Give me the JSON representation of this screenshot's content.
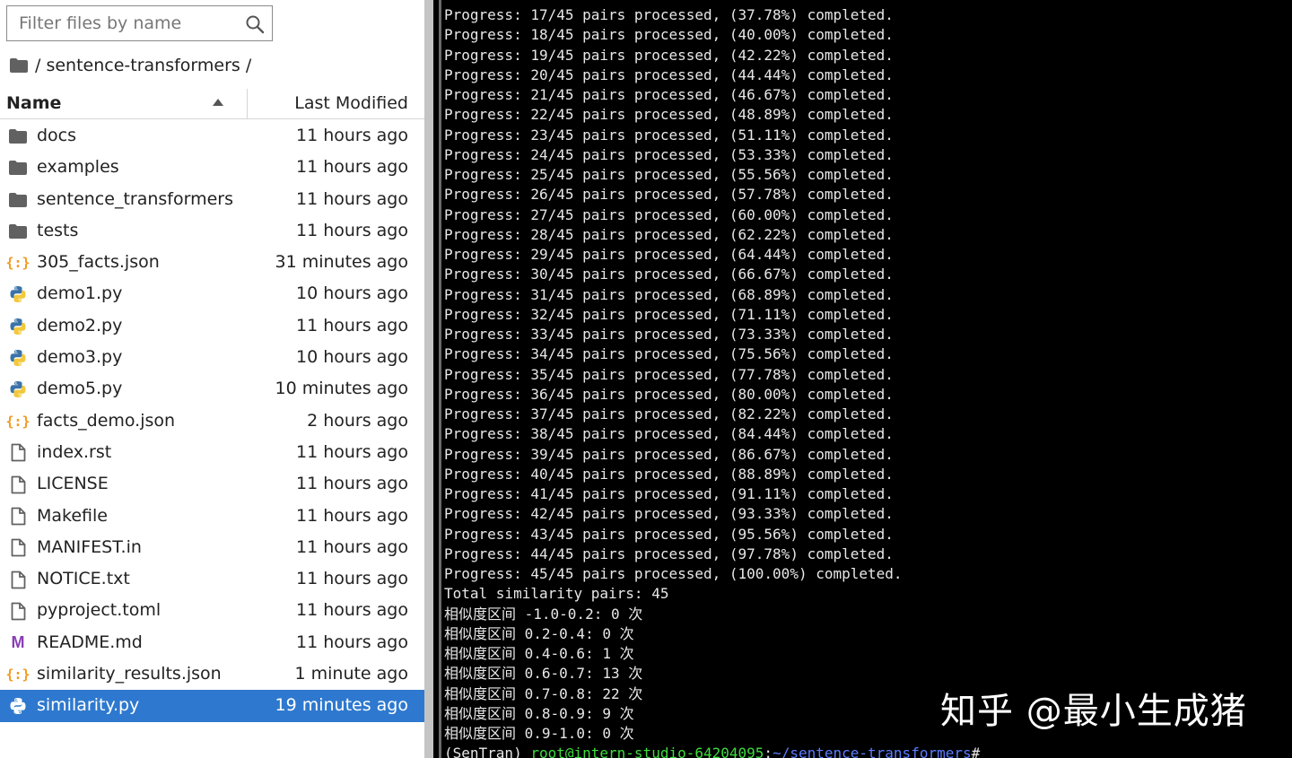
{
  "file_browser": {
    "search": {
      "placeholder": "Filter files by name",
      "value": ""
    },
    "breadcrumb": {
      "path": "/ sentence-transformers /"
    },
    "columns": {
      "name": "Name",
      "modified": "Last Modified"
    },
    "files": [
      {
        "name": "docs",
        "modified": "11 hours ago",
        "icon": "folder-icon"
      },
      {
        "name": "examples",
        "modified": "11 hours ago",
        "icon": "folder-icon"
      },
      {
        "name": "sentence_transformers",
        "modified": "11 hours ago",
        "icon": "folder-icon"
      },
      {
        "name": "tests",
        "modified": "11 hours ago",
        "icon": "folder-icon"
      },
      {
        "name": "305_facts.json",
        "modified": "31 minutes ago",
        "icon": "json-icon"
      },
      {
        "name": "demo1.py",
        "modified": "10 hours ago",
        "icon": "python-icon"
      },
      {
        "name": "demo2.py",
        "modified": "11 hours ago",
        "icon": "python-icon"
      },
      {
        "name": "demo3.py",
        "modified": "10 hours ago",
        "icon": "python-icon"
      },
      {
        "name": "demo5.py",
        "modified": "10 minutes ago",
        "icon": "python-icon"
      },
      {
        "name": "facts_demo.json",
        "modified": "2 hours ago",
        "icon": "json-icon"
      },
      {
        "name": "index.rst",
        "modified": "11 hours ago",
        "icon": "file-icon"
      },
      {
        "name": "LICENSE",
        "modified": "11 hours ago",
        "icon": "file-icon"
      },
      {
        "name": "Makefile",
        "modified": "11 hours ago",
        "icon": "file-icon"
      },
      {
        "name": "MANIFEST.in",
        "modified": "11 hours ago",
        "icon": "file-icon"
      },
      {
        "name": "NOTICE.txt",
        "modified": "11 hours ago",
        "icon": "file-icon"
      },
      {
        "name": "pyproject.toml",
        "modified": "11 hours ago",
        "icon": "file-icon"
      },
      {
        "name": "README.md",
        "modified": "11 hours ago",
        "icon": "markdown-icon"
      },
      {
        "name": "similarity_results.json",
        "modified": "1 minute ago",
        "icon": "json-icon"
      },
      {
        "name": "similarity.py",
        "modified": "19 minutes ago",
        "icon": "python-icon",
        "selected": true
      }
    ]
  },
  "terminal": {
    "lines": [
      "Progress: 17/45 pairs processed, (37.78%) completed.",
      "Progress: 18/45 pairs processed, (40.00%) completed.",
      "Progress: 19/45 pairs processed, (42.22%) completed.",
      "Progress: 20/45 pairs processed, (44.44%) completed.",
      "Progress: 21/45 pairs processed, (46.67%) completed.",
      "Progress: 22/45 pairs processed, (48.89%) completed.",
      "Progress: 23/45 pairs processed, (51.11%) completed.",
      "Progress: 24/45 pairs processed, (53.33%) completed.",
      "Progress: 25/45 pairs processed, (55.56%) completed.",
      "Progress: 26/45 pairs processed, (57.78%) completed.",
      "Progress: 27/45 pairs processed, (60.00%) completed.",
      "Progress: 28/45 pairs processed, (62.22%) completed.",
      "Progress: 29/45 pairs processed, (64.44%) completed.",
      "Progress: 30/45 pairs processed, (66.67%) completed.",
      "Progress: 31/45 pairs processed, (68.89%) completed.",
      "Progress: 32/45 pairs processed, (71.11%) completed.",
      "Progress: 33/45 pairs processed, (73.33%) completed.",
      "Progress: 34/45 pairs processed, (75.56%) completed.",
      "Progress: 35/45 pairs processed, (77.78%) completed.",
      "Progress: 36/45 pairs processed, (80.00%) completed.",
      "Progress: 37/45 pairs processed, (82.22%) completed.",
      "Progress: 38/45 pairs processed, (84.44%) completed.",
      "Progress: 39/45 pairs processed, (86.67%) completed.",
      "Progress: 40/45 pairs processed, (88.89%) completed.",
      "Progress: 41/45 pairs processed, (91.11%) completed.",
      "Progress: 42/45 pairs processed, (93.33%) completed.",
      "Progress: 43/45 pairs processed, (95.56%) completed.",
      "Progress: 44/45 pairs processed, (97.78%) completed.",
      "Progress: 45/45 pairs processed, (100.00%) completed.",
      "Total similarity pairs: 45",
      "相似度区间 -1.0-0.2: 0 次",
      "相似度区间 0.2-0.4: 0 次",
      "相似度区间 0.4-0.6: 1 次",
      "相似度区间 0.6-0.7: 13 次",
      "相似度区间 0.7-0.8: 22 次",
      "相似度区间 0.8-0.9: 9 次",
      "相似度区间 0.9-1.0: 0 次"
    ],
    "prompt": {
      "env": "(SenTran) ",
      "user_host": "root@intern-studio-64204095",
      "path": "~/sentence-transformers",
      "symbol": "#"
    }
  },
  "watermark": "知乎 @最小生成猪",
  "colors": {
    "selected_row": "#2e79cf",
    "json_icon": "#f29a1f",
    "markdown_icon": "#8a3db6",
    "python_blue": "#3b73a8",
    "python_yellow": "#f2c83a",
    "prompt_user": "#3ddc3d",
    "prompt_path": "#5c7cff"
  }
}
